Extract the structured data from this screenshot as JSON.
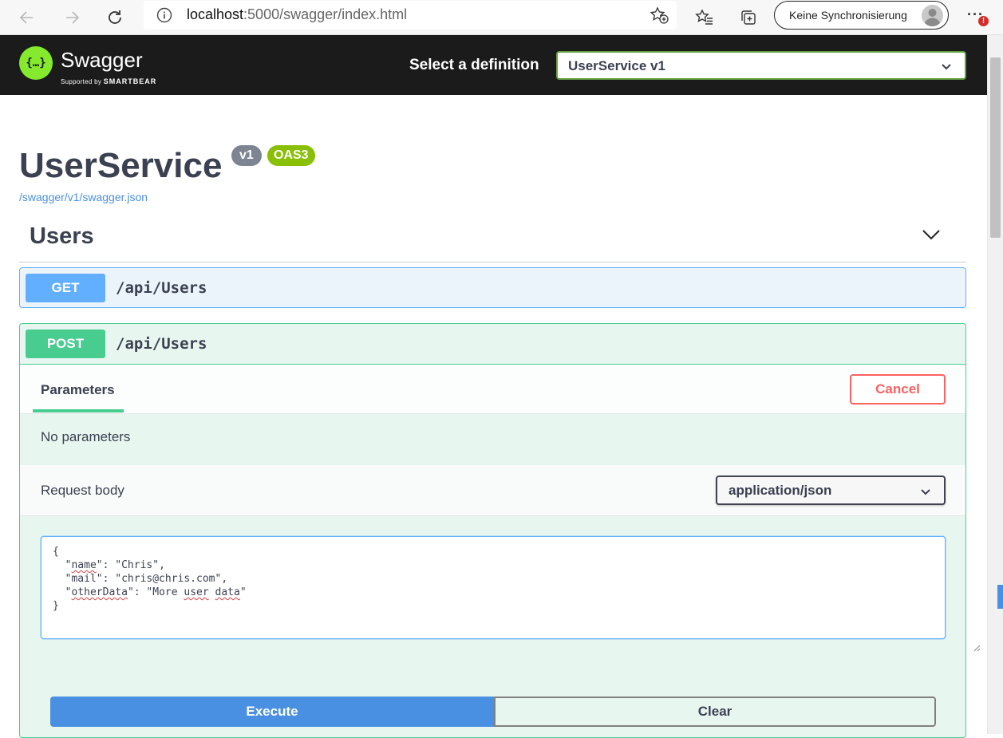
{
  "browser": {
    "url_host": "localhost",
    "url_path": ":5000/swagger/index.html",
    "sync_label": "Keine Synchronisierung",
    "more_label": "···",
    "alert_badge": "!"
  },
  "topbar": {
    "logo_glyph": "{…}",
    "logo_text": "Swagger",
    "logo_sub_prefix": "Supported by",
    "logo_sub_brand": "SMARTBEAR",
    "select_label": "Select a definition",
    "definition_value": "UserService v1"
  },
  "info": {
    "title": "UserService",
    "version_badge": "v1",
    "oas_badge": "OAS3",
    "spec_link": "/swagger/v1/swagger.json"
  },
  "tag": {
    "name": "Users"
  },
  "operations": [
    {
      "method": "GET",
      "path": "/api/Users"
    },
    {
      "method": "POST",
      "path": "/api/Users"
    }
  ],
  "post_panel": {
    "tab_label": "Parameters",
    "cancel_label": "Cancel",
    "no_params": "No parameters",
    "request_body_label": "Request body",
    "content_type": "application/json",
    "body_lines": {
      "open": "{",
      "name_key": "name",
      "name_val": ": \"Chris\",",
      "mail_line": "  \"mail\": \"chris@chris.com\",",
      "other_key": "otherData",
      "other_val_prefix": ": \"More ",
      "other_val_user": "user",
      "other_val_data": "data",
      "close": "}"
    },
    "execute_label": "Execute",
    "clear_label": "Clear"
  },
  "colors": {
    "get": "#61affe",
    "post": "#49cc90",
    "cancel": "#ff6060",
    "execute": "#4990e2",
    "swagger_green": "#85ea2d"
  }
}
